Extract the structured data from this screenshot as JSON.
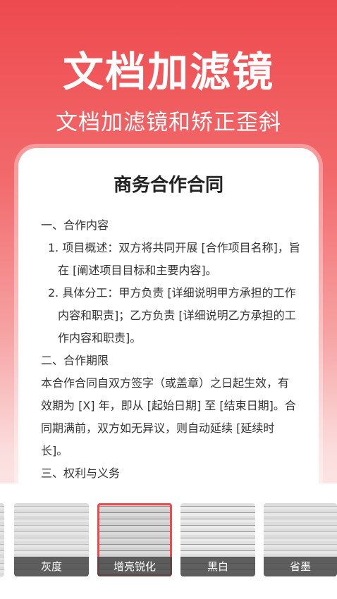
{
  "hero": {
    "title": "文档加滤镜",
    "subtitle": "文档加滤镜和矫正歪斜"
  },
  "document": {
    "title": "商务合作合同",
    "lines": [
      "一、合作内容",
      "1. 项目概述：双方将共同开展 [合作项目名称]，旨",
      "在 [阐述项目目标和主要内容]。",
      "2. 具体分工：甲方负责 [详细说明甲方承担的工作",
      "内容和职责]；乙方负责 [详细说明乙方承担的工",
      "作内容和职责]。",
      "二、合作期限",
      "本合作合同自双方签字（或盖章）之日起生效，有",
      "效期为 [X] 年，即从 [起始日期] 至 [结束日期]。合",
      "同期满前，双方如无异议，则自动延续 [延续时",
      "长]。",
      "三、权利与义务"
    ]
  },
  "filters": [
    {
      "label": "灰度",
      "selected": false
    },
    {
      "label": "增亮锐化",
      "selected": true
    },
    {
      "label": "黑白",
      "selected": false
    },
    {
      "label": "省墨",
      "selected": false
    }
  ],
  "colors": {
    "accent": "#ee4a4e"
  }
}
